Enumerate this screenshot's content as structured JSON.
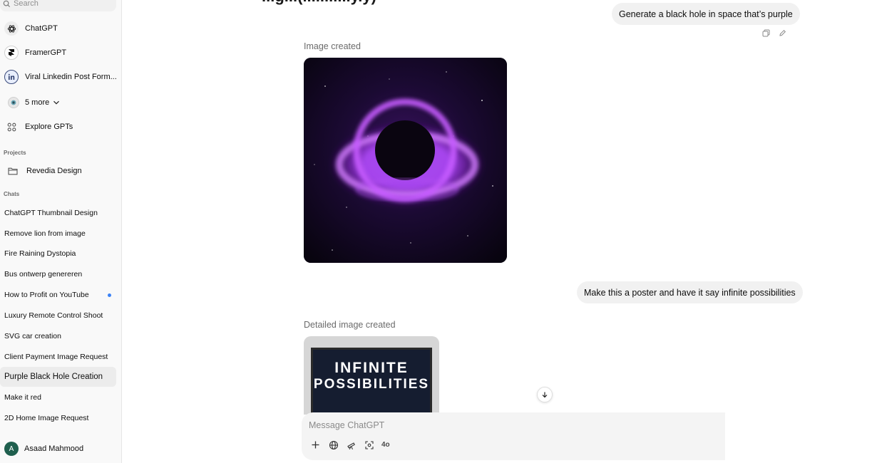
{
  "sidebar": {
    "search_placeholder": "Search",
    "gpts": [
      {
        "label": "ChatGPT",
        "icon": "openai-icon"
      },
      {
        "label": "FramerGPT",
        "icon": "framer-icon"
      },
      {
        "label": "Viral Linkedin Post Form...",
        "icon": "linkedin-icon"
      },
      {
        "label": "5 more",
        "icon": "gpt-icon"
      },
      {
        "label": "Explore GPTs",
        "icon": "grid-icon"
      }
    ],
    "projects_label": "Projects",
    "projects": [
      {
        "label": "Revedia Design"
      }
    ],
    "chats_label": "Chats",
    "chats": [
      {
        "label": "ChatGPT Thumbnail Design"
      },
      {
        "label": "Remove lion from image"
      },
      {
        "label": "Fire Raining Dystopia"
      },
      {
        "label": "Bus ontwerp genereren"
      },
      {
        "label": "How to Profit on YouTube"
      },
      {
        "label": "Luxury Remote Control Shoot"
      },
      {
        "label": "SVG car creation"
      },
      {
        "label": "Client Payment Image Request"
      },
      {
        "label": "Purple Black Hole Creation"
      },
      {
        "label": "Make it red"
      },
      {
        "label": "2D Home Image Request"
      }
    ],
    "user": {
      "initial": "A",
      "name": "Asaad Mahmood"
    }
  },
  "conversation": {
    "top_title": "...g...(...........y.y)",
    "user_message_1": "Generate a black hole in space that’s purple",
    "image_created_label": "Image created",
    "user_message_2": "Make this a poster and have it say infinite possibilities",
    "detailed_image_label": "Detailed image created",
    "poster_line_1": "INFINITE",
    "poster_line_2": "POSSIBILITIES"
  },
  "composer": {
    "placeholder": "Message ChatGPT",
    "model_label": "4o"
  },
  "colors": {
    "accent_dot": "#3b82f6",
    "avatar": "#1f5f4e",
    "black_hole_glow": "#b44cff"
  }
}
